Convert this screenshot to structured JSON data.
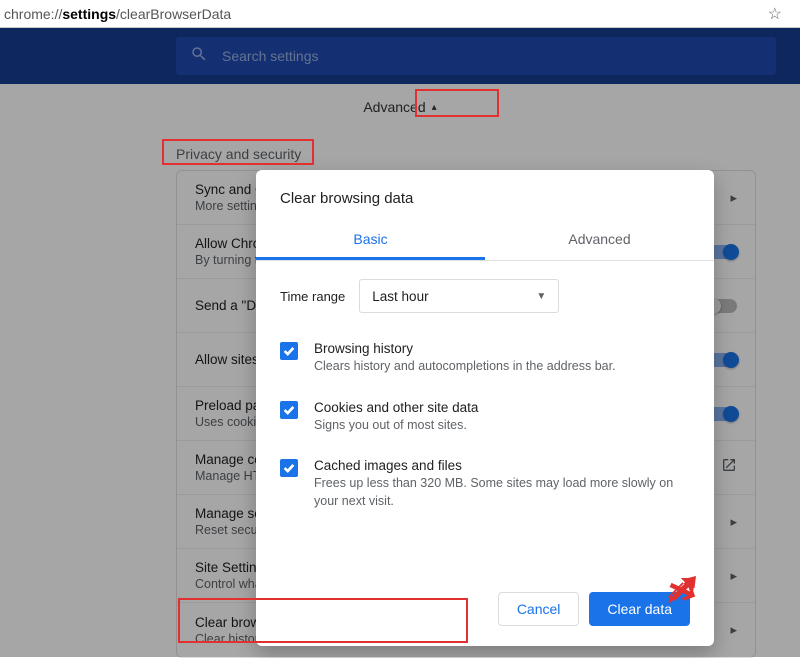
{
  "address_bar": {
    "url_pre": "chrome://",
    "url_bold": "settings",
    "url_post": "/clearBrowserData"
  },
  "search": {
    "placeholder": "Search settings"
  },
  "advanced": {
    "label": "Advanced"
  },
  "section": {
    "title": "Privacy and security"
  },
  "rows": [
    {
      "title": "Sync and Google services",
      "sub": "More settings that relate to privacy, security, and data collection",
      "toggle": null,
      "ext": false
    },
    {
      "title": "Allow Chrome sign-in",
      "sub": "By turning this off, you can sign in to Google sites like Gmail without signing in to Chrome",
      "toggle": true,
      "ext": false
    },
    {
      "title": "Send a \"Do Not Track\" request with your browsing traffic",
      "sub": "",
      "toggle": false,
      "ext": false
    },
    {
      "title": "Allow sites to check if you have payment methods saved",
      "sub": "",
      "toggle": true,
      "ext": false
    },
    {
      "title": "Preload pages for faster browsing and searching",
      "sub": "Uses cookies to remember your preferences, even if you don't visit those pages",
      "toggle": true,
      "ext": false
    },
    {
      "title": "Manage certificates",
      "sub": "Manage HTTPS/SSL certificates and settings",
      "toggle": null,
      "ext": true
    },
    {
      "title": "Manage security keys",
      "sub": "Reset security keys and create PINs",
      "toggle": null,
      "ext": false
    },
    {
      "title": "Site Settings",
      "sub": "Control what information websites can use and what content they can show you",
      "toggle": null,
      "ext": false
    },
    {
      "title": "Clear browsing data",
      "sub": "Clear history, cookies, cache, and more",
      "toggle": null,
      "ext": false
    }
  ],
  "modal": {
    "title": "Clear browsing data",
    "tabs": {
      "basic": "Basic",
      "advanced": "Advanced"
    },
    "time_label": "Time range",
    "time_value": "Last hour",
    "opts": [
      {
        "title": "Browsing history",
        "sub": "Clears history and autocompletions in the address bar."
      },
      {
        "title": "Cookies and other site data",
        "sub": "Signs you out of most sites."
      },
      {
        "title": "Cached images and files",
        "sub": "Frees up less than 320 MB. Some sites may load more slowly on your next visit."
      }
    ],
    "cancel": "Cancel",
    "clear": "Clear data"
  }
}
